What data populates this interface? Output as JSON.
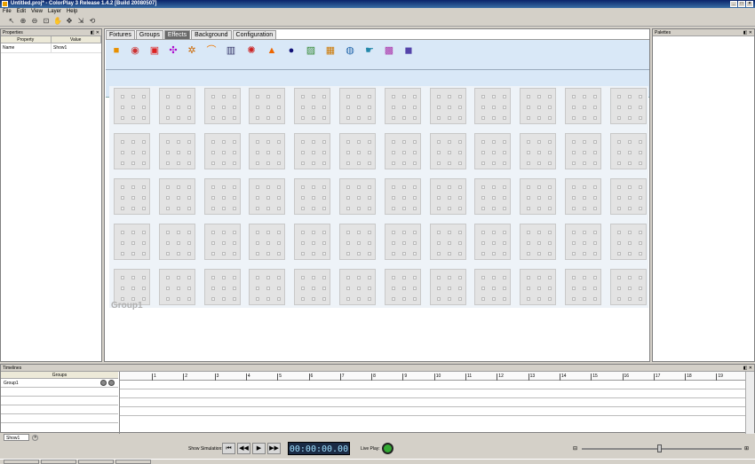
{
  "window": {
    "title": "Untitled.proj* - ColorPlay 3 Release 1.4.2 [Build 20080507]"
  },
  "menu": [
    "File",
    "Edit",
    "View",
    "Layer",
    "Help"
  ],
  "toolbar_icons": [
    "select-arrow-icon",
    "zoom-in-icon",
    "zoom-out-icon",
    "fit-view-icon",
    "pan-hand-icon",
    "move-icon",
    "align-icon",
    "rotate-icon"
  ],
  "properties": {
    "title": "Properties",
    "col_property": "Property",
    "col_value": "Value",
    "rows": [
      {
        "name": "Name",
        "value": "Show1"
      }
    ]
  },
  "palettes": {
    "title": "Palettes"
  },
  "tabs": [
    "Fixtures",
    "Groups",
    "Effects",
    "Background",
    "Configuration"
  ],
  "active_tab": "Effects",
  "effect_icons": [
    "solid-color-icon",
    "color-wheel-icon",
    "gradient-icon",
    "network-icon",
    "sparkle-icon",
    "rainbow-icon",
    "bars-icon",
    "spin-icon",
    "fire-icon",
    "dot-icon",
    "image-icon",
    "blocks-icon",
    "globe-icon",
    "hand-icon",
    "mosaic-icon",
    "text-icon"
  ],
  "group": {
    "label": "Group1",
    "rows": 5,
    "cols": 12
  },
  "timelines": {
    "title": "Timelines",
    "groups_header": "Groups",
    "rows": [
      "Group1",
      "",
      "",
      "",
      ""
    ],
    "ruler_ticks": [
      "1",
      "2",
      "3",
      "4",
      "5",
      "6",
      "7",
      "8",
      "9",
      "10",
      "11",
      "12",
      "13",
      "14",
      "15",
      "16",
      "17",
      "18",
      "19"
    ]
  },
  "sheet_tabs": [
    "Show1"
  ],
  "transport": {
    "show_simulation_label": "Show Simulation:",
    "time": "00:00:00.00",
    "live_play_label": "Live Play:"
  }
}
